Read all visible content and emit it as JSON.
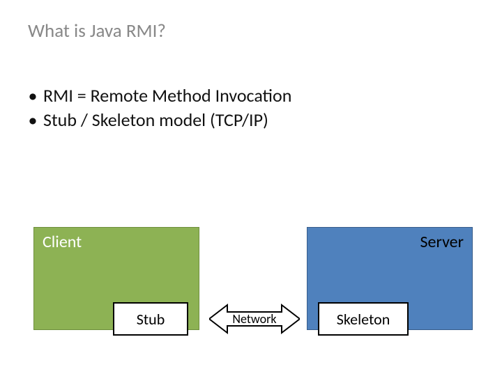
{
  "title": "What is Java RMI?",
  "bullets": [
    "RMI = Remote Method Invocation",
    "Stub / Skeleton model (TCP/IP)"
  ],
  "diagram": {
    "client_label": "Client",
    "server_label": "Server",
    "stub_label": "Stub",
    "skeleton_label": "Skeleton",
    "network_label": "Network"
  }
}
